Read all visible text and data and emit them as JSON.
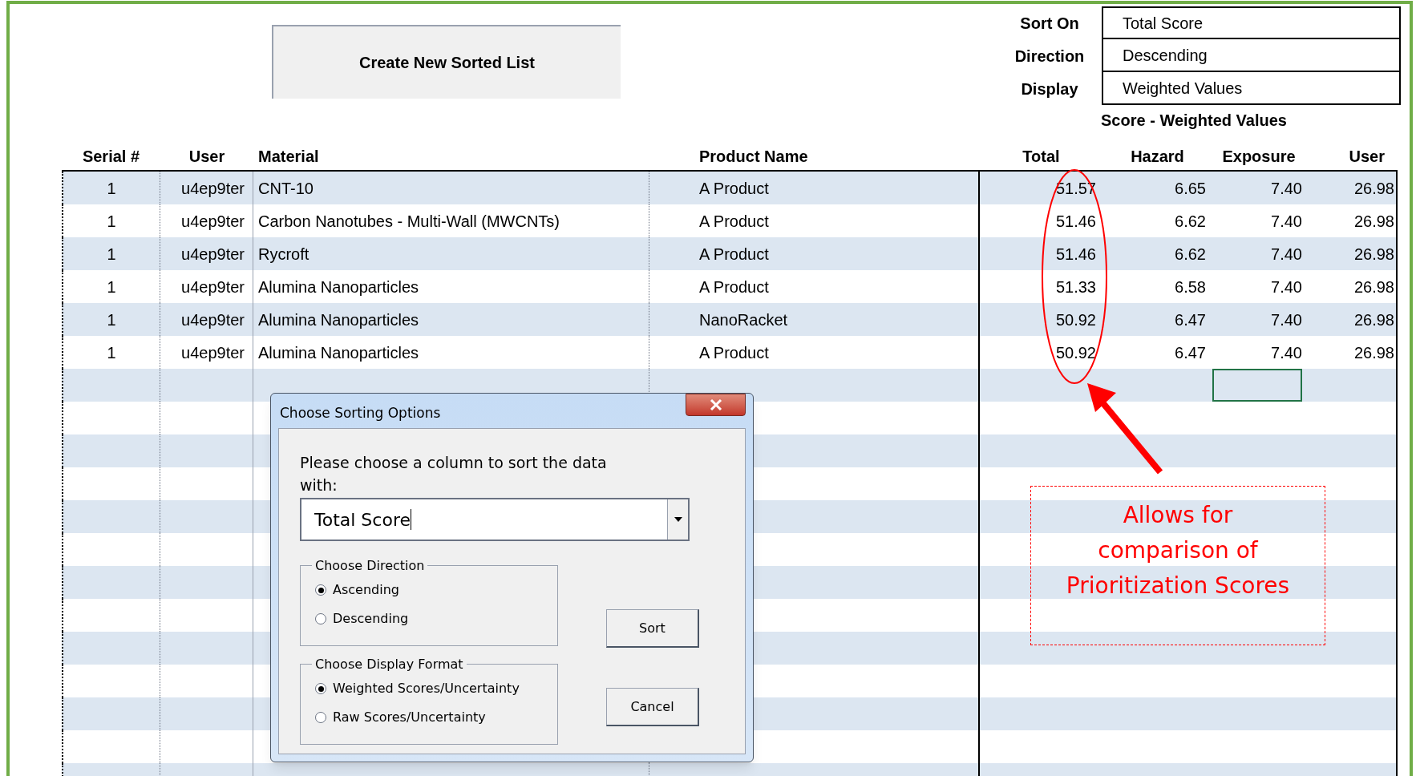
{
  "toolbar": {
    "create_button": "Create New Sorted List"
  },
  "sort_info": [
    {
      "label": "Sort On",
      "value": "Total Score"
    },
    {
      "label": "Direction",
      "value": "Descending"
    },
    {
      "label": "Display",
      "value": "Weighted Values"
    }
  ],
  "score_group_title": "Score - Weighted Values",
  "table": {
    "columns": [
      "Serial #",
      "User",
      "Material",
      "Product Name",
      "Total",
      "Hazard",
      "Exposure",
      "User"
    ],
    "rows": [
      [
        "1",
        "u4ep9ter",
        "CNT-10",
        "A Product",
        "51.57",
        "6.65",
        "7.40",
        "26.98"
      ],
      [
        "1",
        "u4ep9ter",
        "Carbon Nanotubes - Multi-Wall (MWCNTs)",
        "A Product",
        "51.46",
        "6.62",
        "7.40",
        "26.98"
      ],
      [
        "1",
        "u4ep9ter",
        "Rycroft",
        "A Product",
        "51.46",
        "6.62",
        "7.40",
        "26.98"
      ],
      [
        "1",
        "u4ep9ter",
        "Alumina Nanoparticles",
        "A Product",
        "51.33",
        "6.58",
        "7.40",
        "26.98"
      ],
      [
        "1",
        "u4ep9ter",
        "Alumina Nanoparticles",
        "NanoRacket",
        "50.92",
        "6.47",
        "7.40",
        "26.98"
      ],
      [
        "1",
        "u4ep9ter",
        "Alumina Nanoparticles",
        "A Product",
        "50.92",
        "6.47",
        "7.40",
        "26.98"
      ]
    ]
  },
  "dialog": {
    "title": "Choose Sorting Options",
    "prompt": "Please choose a column to sort the data with:",
    "column_select": {
      "value": "Total Score"
    },
    "groups": [
      {
        "title": "Choose Direction",
        "options": [
          {
            "label": "Ascending",
            "selected": true
          },
          {
            "label": "Descending",
            "selected": false
          }
        ]
      },
      {
        "title": "Choose Display Format",
        "options": [
          {
            "label": "Weighted Scores/Uncertainty",
            "selected": true
          },
          {
            "label": "Raw Scores/Uncertainty",
            "selected": false
          }
        ]
      }
    ],
    "buttons": [
      "Sort",
      "Cancel"
    ]
  },
  "callout": "Allows for comparison of Prioritization Scores"
}
